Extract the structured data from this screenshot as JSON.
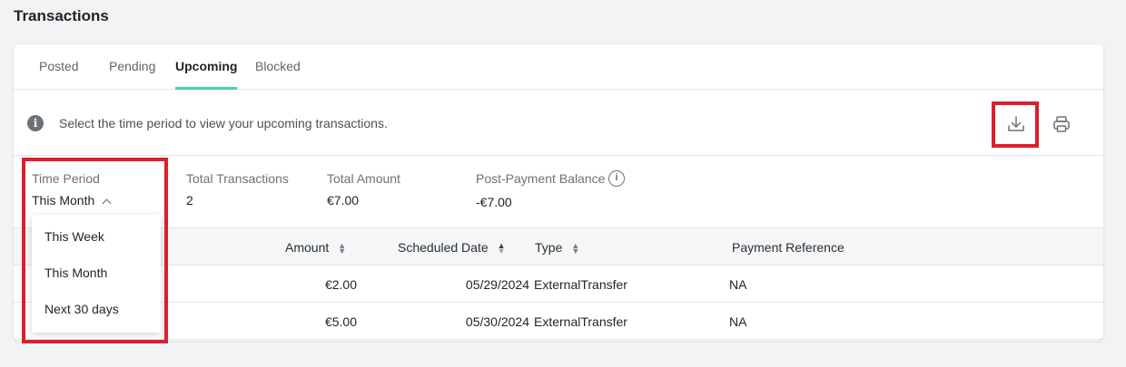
{
  "page": {
    "title": "Transactions"
  },
  "tabs": [
    {
      "label": "Posted"
    },
    {
      "label": "Pending"
    },
    {
      "label": "Upcoming"
    },
    {
      "label": "Blocked"
    }
  ],
  "info": {
    "text": "Select the time period to view your upcoming transactions."
  },
  "summary": {
    "time_period_label": "Time Period",
    "time_period_value": "This Month",
    "total_transactions_label": "Total Transactions",
    "total_transactions_value": "2",
    "total_amount_label": "Total Amount",
    "total_amount_value": "€7.00",
    "post_payment_label": "Post-Payment Balance",
    "post_payment_value": "-€7.00"
  },
  "dropdown": {
    "options": [
      "This Week",
      "This Month",
      "Next 30 days"
    ]
  },
  "table": {
    "headers": [
      "Amount",
      "Scheduled Date",
      "Type",
      "Payment Reference"
    ],
    "rows": [
      {
        "amount": "€2.00",
        "date": "05/29/2024",
        "type": "ExternalTransfer",
        "ref": "NA"
      },
      {
        "amount": "€5.00",
        "date": "05/30/2024",
        "type": "ExternalTransfer",
        "ref": "NA"
      }
    ]
  },
  "colors": {
    "accent": "#3ed7b0",
    "highlight": "#e01e2b"
  }
}
